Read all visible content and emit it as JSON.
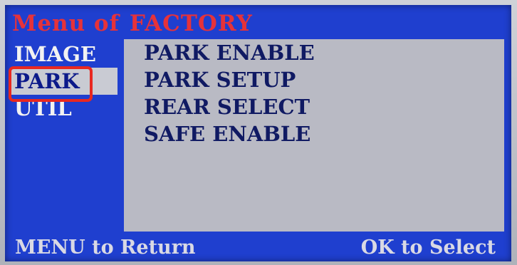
{
  "title": {
    "prefix": "Menu of",
    "name": "FACTORY"
  },
  "side_menu": {
    "items": [
      {
        "label": "IMAGE",
        "selected": false
      },
      {
        "label": "PARK",
        "selected": true
      },
      {
        "label": "UTIL",
        "selected": false
      }
    ],
    "highlight_color": "#e82820"
  },
  "content": {
    "items": [
      {
        "label": "PARK ENABLE"
      },
      {
        "label": "PARK SETUP"
      },
      {
        "label": "REAR SELECT"
      },
      {
        "label": "SAFE ENABLE"
      }
    ]
  },
  "footer": {
    "left": "MENU to Return",
    "right": "OK to Select"
  },
  "colors": {
    "screen_background": "#1f3fcf",
    "title_text": "#e6323a",
    "panel_background": "#b9bac4",
    "panel_text": "#101a63"
  }
}
